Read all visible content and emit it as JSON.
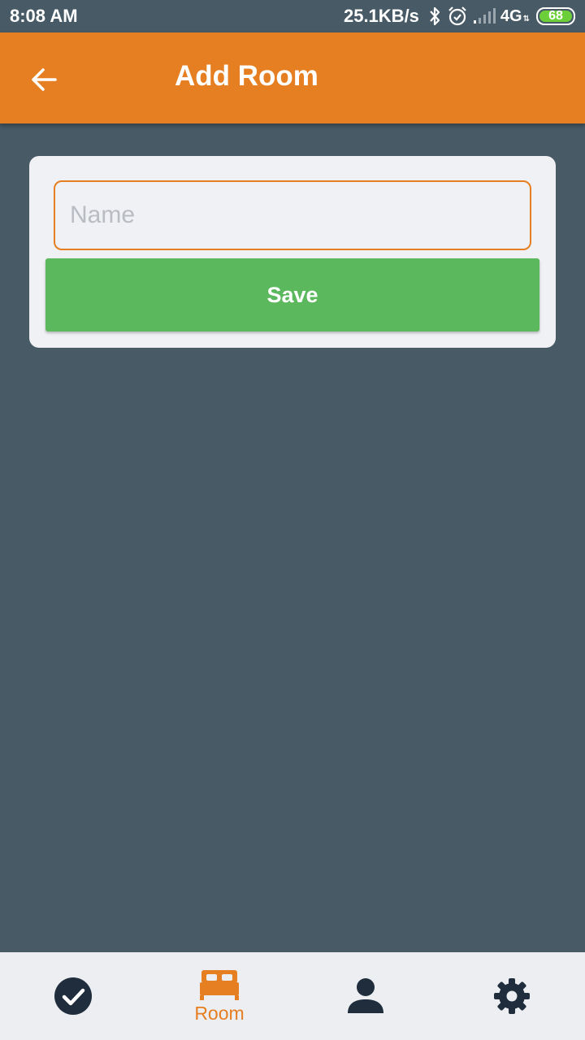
{
  "status_bar": {
    "time": "8:08 AM",
    "net_speed": "25.1KB/s",
    "network_type": "4G",
    "battery_level": "68",
    "icons": [
      "bluetooth-icon",
      "alarm-icon",
      "signal-icon",
      "battery-icon"
    ]
  },
  "app_bar": {
    "title": "Add Room",
    "back_icon": "arrow-left-icon"
  },
  "form": {
    "name_placeholder": "Name",
    "name_value": "",
    "save_label": "Save"
  },
  "bottom_nav": {
    "items": [
      {
        "icon": "check-circle-icon",
        "label": ""
      },
      {
        "icon": "bed-icon",
        "label": "Room",
        "active": true
      },
      {
        "icon": "user-icon",
        "label": ""
      },
      {
        "icon": "gear-icon",
        "label": ""
      }
    ]
  },
  "colors": {
    "accent": "#e67e22",
    "background": "#475a66",
    "card": "#f0f1f5",
    "save_button": "#5cb85c",
    "nav_icon": "#1f2d3d",
    "battery_fill": "#6ccf3a"
  }
}
